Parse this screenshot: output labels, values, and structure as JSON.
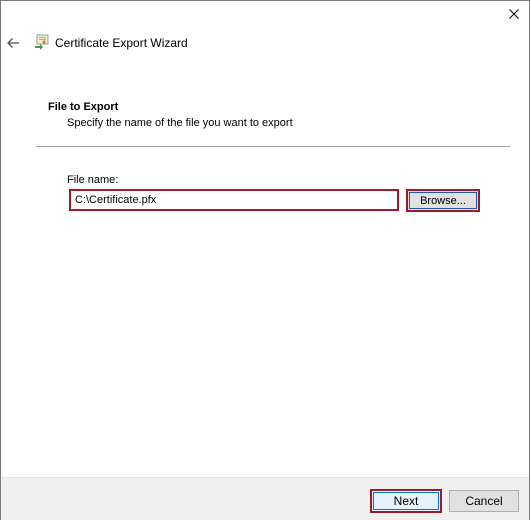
{
  "window": {
    "title": "Certificate Export Wizard"
  },
  "page": {
    "heading": "File to Export",
    "description": "Specify the name of the file you want to export"
  },
  "file_name": {
    "label": "File name:",
    "value": "C:\\Certificate.pfx",
    "browse_label": "Browse..."
  },
  "footer": {
    "next_label": "Next",
    "cancel_label": "Cancel"
  },
  "colors": {
    "highlight_border": "#9a1b2a",
    "focus_blue": "#0078d7",
    "footer_bg": "#f0f0f0"
  },
  "icons": {
    "close": "close-icon",
    "back": "back-arrow-icon",
    "wizard": "certificate-icon"
  }
}
